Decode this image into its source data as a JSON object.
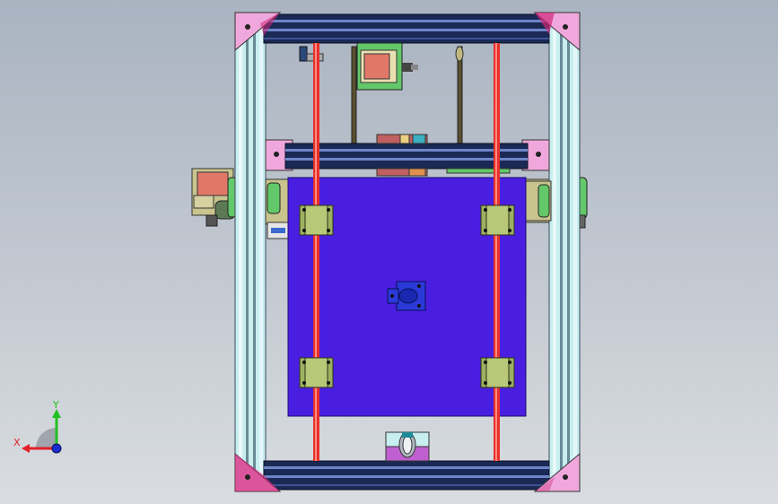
{
  "viewport": {
    "background_top": "#a9b3c1",
    "background_bottom": "#d9dde1"
  },
  "triad": {
    "x_label": "X",
    "y_label": "Y",
    "x_color": "#e0202a",
    "y_color": "#20c020",
    "z_color": "#1c2cd0"
  },
  "model": {
    "frame_color": "#c8eef0",
    "extrusion_color": "#1a2a55",
    "corner_bracket_color": "#f0a8dc",
    "rod_color": "#e8302a",
    "bed_color": "#4a1ee0",
    "bearing_color": "#9cb060",
    "motor_body_color": "#e07868",
    "pulley_color": "#c060d0"
  }
}
